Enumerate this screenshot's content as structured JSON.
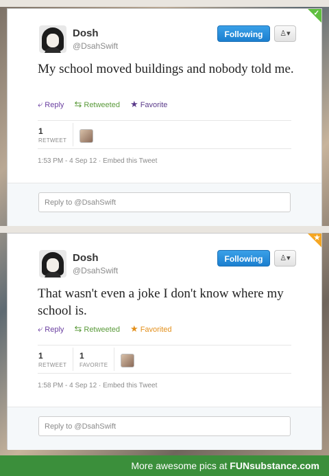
{
  "tweets": [
    {
      "name": "Dosh",
      "handle": "@DsahSwift",
      "follow_label": "Following",
      "user_menu_icon": "user-dropdown-icon",
      "text": "My school moved buildings and nobody told me.",
      "actions": {
        "reply": "Reply",
        "retweet": "Retweeted",
        "favorite": "Favorite"
      },
      "stats": [
        {
          "count": "1",
          "label": "RETWEET"
        }
      ],
      "timestamp": "1:53 PM - 4 Sep 12",
      "embed_label": "Embed this Tweet",
      "reply_placeholder": "Reply to @DsahSwift",
      "corner_color": "#5fbf3f"
    },
    {
      "name": "Dosh",
      "handle": "@DsahSwift",
      "follow_label": "Following",
      "user_menu_icon": "user-dropdown-icon",
      "text": "That wasn't even a joke I don't know where my school is.",
      "actions": {
        "reply": "Reply",
        "retweet": "Retweeted",
        "favorite": "Favorited"
      },
      "stats": [
        {
          "count": "1",
          "label": "RETWEET"
        },
        {
          "count": "1",
          "label": "FAVORITE"
        }
      ],
      "timestamp": "1:58 PM - 4 Sep 12",
      "embed_label": "Embed this Tweet",
      "reply_placeholder": "Reply to @DsahSwift",
      "corner_color": "#f5a623"
    }
  ],
  "footer": {
    "prefix": "More awesome pics at ",
    "brand": "FUNsubstance.com"
  },
  "colors": {
    "follow_blue": "#1b7fcf",
    "footer_green": "#3b8f3b",
    "reply_purple": "#6a3fa0",
    "retweet_green": "#5a9a3a",
    "favorited_orange": "#e38f1a"
  }
}
